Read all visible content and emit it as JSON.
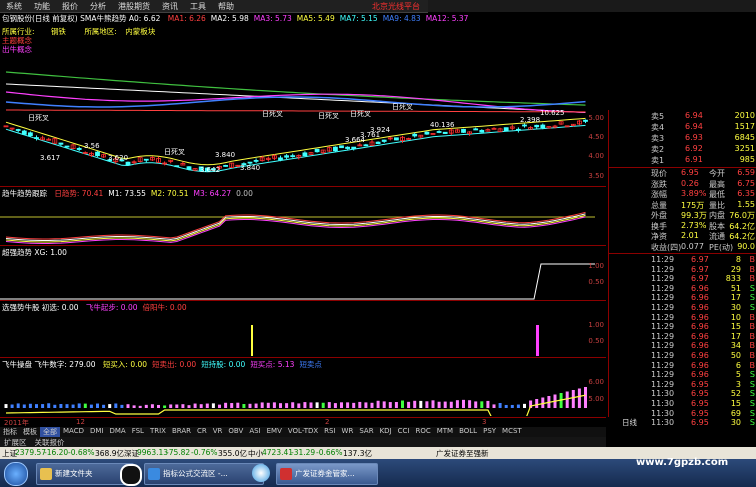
{
  "menu": {
    "items": [
      "系统",
      "功能",
      "报价",
      "分析",
      "港股期货",
      "资讯",
      "工具",
      "帮助"
    ],
    "right_title": "北京光线平台"
  },
  "main_pane": {
    "title": "包钢股份(日线 前复权) SMA牛熊趋势  A0: 6.62",
    "ma_labels": [
      {
        "t": "MA1: 6.26",
        "c": "#ff4040"
      },
      {
        "t": "MA2: 5.98",
        "c": "#ffffff"
      },
      {
        "t": "MA3: 5.73",
        "c": "#ff40ff"
      },
      {
        "t": "MA5: 5.49",
        "c": "#ffff40"
      },
      {
        "t": "MA7: 5.15",
        "c": "#40ffff"
      },
      {
        "t": "MA9: 4.83",
        "c": "#4080ff"
      },
      {
        "t": "MA12: 5.37",
        "c": "#ff40ff"
      }
    ],
    "info1_a": "所属行业:",
    "info1_b": "钢铁",
    "info1_c": "所属地区:",
    "info1_d": "内蒙板块",
    "info2": "主题概念",
    "info3": "出牛概念",
    "yticks": [
      "5.00",
      "4.50",
      "4.00",
      "3.50"
    ],
    "annotations": [
      "日死叉",
      "日死叉",
      "日死叉",
      "日死叉",
      "日死叉",
      "日死叉"
    ],
    "prices": [
      "3.617",
      "3.840",
      "3.840",
      "3.642",
      "3.620",
      "10.625",
      "2.398",
      "40.136",
      "3.924",
      "3.761",
      "3.664",
      "3.56"
    ]
  },
  "pane2": {
    "title": "趋牛趋势跟踪",
    "labels": [
      {
        "t": "日趋势: 70.41",
        "c": "#ff4040"
      },
      {
        "t": "M1: 73.55",
        "c": "#ffffff"
      },
      {
        "t": "M2: 70.51",
        "c": "#ffff40"
      },
      {
        "t": "M3: 64.27",
        "c": "#ff40ff"
      },
      {
        "t": "0.00",
        "c": "#c0c0c0"
      }
    ]
  },
  "pane3": {
    "title": "超强趋势 XG: 1.00",
    "yticks": [
      "1.00",
      "0.50"
    ]
  },
  "pane4": {
    "title": "选强势牛股  初选: 0.00",
    "labels": [
      {
        "t": "飞牛起步: 0.00",
        "c": "#ff40ff"
      },
      {
        "t": "倍阳牛: 0.00",
        "c": "#ff4040"
      }
    ],
    "yticks": [
      "1.00",
      "0.50"
    ]
  },
  "pane5": {
    "title": "飞牛操盘  飞牛数字: 279.00",
    "labels": [
      {
        "t": "短买入: 0.00",
        "c": "#ffff40"
      },
      {
        "t": "短卖出: 0.00",
        "c": "#ff4040"
      },
      {
        "t": "短持股: 0.00",
        "c": "#40ffff"
      },
      {
        "t": "短买点: 5.13",
        "c": "#ff40ff"
      },
      {
        "t": "短卖点",
        "c": "#4080ff"
      }
    ],
    "yticks": [
      "6.00",
      "5.00"
    ]
  },
  "xaxis": [
    "2011年",
    "12",
    "2",
    "3"
  ],
  "index_tabs": [
    "指标",
    "模板",
    "全部",
    "MACD",
    "DMI",
    "DMA",
    "FSL",
    "TRIX",
    "BRAR",
    "CR",
    "VR",
    "OBV",
    "ASI",
    "EMV",
    "VOL-TDX",
    "RSI",
    "WR",
    "SAR",
    "KDJ",
    "CCI",
    "ROC",
    "MTM",
    "BOLL",
    "PSY",
    "MCST"
  ],
  "sub_tabs": [
    "扩展区",
    "关联报价"
  ],
  "side_button": "日线",
  "quote": {
    "asks": [
      {
        "l": "卖5",
        "p": "6.94",
        "v": "2010"
      },
      {
        "l": "卖4",
        "p": "6.94",
        "v": "1517"
      },
      {
        "l": "卖3",
        "p": "6.93",
        "v": "6845"
      },
      {
        "l": "卖2",
        "p": "6.92",
        "v": "3251"
      },
      {
        "l": "卖1",
        "p": "6.91",
        "v": "985"
      }
    ],
    "stats": [
      {
        "a": "现价",
        "b": "6.95",
        "c": "今开",
        "d": "6.59"
      },
      {
        "a": "涨跌",
        "b": "0.26",
        "c": "最高",
        "d": "6.75"
      },
      {
        "a": "涨幅",
        "b": "3.89%",
        "c": "最低",
        "d": "6.35"
      },
      {
        "a": "总量",
        "b": "175万",
        "c": "量比",
        "d": "1.55"
      },
      {
        "a": "外盘",
        "b": "99.3万",
        "c": "内盘",
        "d": "76.0万"
      },
      {
        "a": "换手",
        "b": "2.73%",
        "c": "股本",
        "d": "64.2亿"
      },
      {
        "a": "净资",
        "b": "2.01",
        "c": "流通",
        "d": "64.2亿"
      },
      {
        "a": "收益(四)",
        "b": "0.077",
        "c": "PE(动)",
        "d": "90.0"
      }
    ],
    "ticks": [
      {
        "t": "11:29",
        "p": "6.97",
        "v": "8",
        "s": "B"
      },
      {
        "t": "11:29",
        "p": "6.97",
        "v": "29",
        "s": "B"
      },
      {
        "t": "11:29",
        "p": "6.97",
        "v": "833",
        "s": "B"
      },
      {
        "t": "11:29",
        "p": "6.96",
        "v": "51",
        "s": "S"
      },
      {
        "t": "11:29",
        "p": "6.96",
        "v": "17",
        "s": "S"
      },
      {
        "t": "11:29",
        "p": "6.96",
        "v": "30",
        "s": "S"
      },
      {
        "t": "11:29",
        "p": "6.96",
        "v": "10",
        "s": "B"
      },
      {
        "t": "11:29",
        "p": "6.96",
        "v": "15",
        "s": "B"
      },
      {
        "t": "11:29",
        "p": "6.96",
        "v": "17",
        "s": "B"
      },
      {
        "t": "11:29",
        "p": "6.96",
        "v": "34",
        "s": "B"
      },
      {
        "t": "11:29",
        "p": "6.96",
        "v": "50",
        "s": "B"
      },
      {
        "t": "11:29",
        "p": "6.96",
        "v": "6",
        "s": "B"
      },
      {
        "t": "11:29",
        "p": "6.96",
        "v": "5",
        "s": "S"
      },
      {
        "t": "11:29",
        "p": "6.95",
        "v": "3",
        "s": "S"
      },
      {
        "t": "11:30",
        "p": "6.95",
        "v": "52",
        "s": "S"
      },
      {
        "t": "11:30",
        "p": "6.95",
        "v": "15",
        "s": "S"
      },
      {
        "t": "11:30",
        "p": "6.95",
        "v": "69",
        "s": "S"
      },
      {
        "t": "11:30",
        "p": "6.95",
        "v": "30",
        "s": "S"
      }
    ]
  },
  "status": {
    "sh_label": "上证",
    "sh_val": "2379.57",
    "sh_chg": "-16.20",
    "sh_pct": "-0.68%",
    "sh_amt": "368.9亿",
    "sz_label": "深证",
    "sz_val": "9963.13",
    "sz_chg": "-75.82",
    "sz_pct": "-0.76%",
    "sz_amt": "355.0亿",
    "zx_label": "中小",
    "zx_val": "4723.41",
    "zx_chg": "-31.29",
    "zx_pct": "-0.66%",
    "zx_amt": "137.3亿",
    "broker": "广发证券至强新"
  },
  "taskbar": {
    "items": [
      "新建文件夹",
      "指标公式交流区 -...",
      "广发证券金管家..."
    ]
  },
  "watermark": "www.7gpzb.com"
}
